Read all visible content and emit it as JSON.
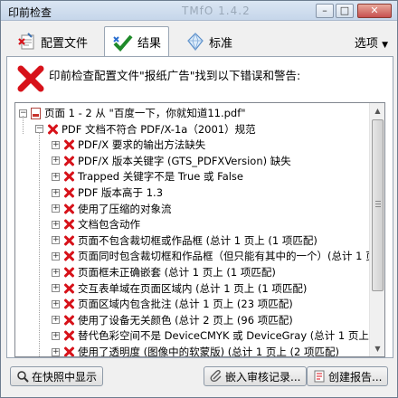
{
  "window": {
    "title": "印前检查",
    "faded_title": "TMfO 1.4.2",
    "buttons": {
      "minimize": "–",
      "maximize": "□",
      "close": "✕"
    }
  },
  "tabs": [
    {
      "label": "配置文件",
      "icon": "profile-icon",
      "active": false
    },
    {
      "label": "结果",
      "icon": "checkmark-icon",
      "active": true
    },
    {
      "label": "标准",
      "icon": "diamond-icon",
      "active": false
    }
  ],
  "options": {
    "label": "选项",
    "icon": "dropdown-arrow-icon"
  },
  "header": {
    "message": "印前检查配置文件\"报纸广告\"找到以下错误和警告:"
  },
  "tree": {
    "items": [
      {
        "text": "页面 1 - 2 从 \"百度一下，你就知道11.pdf\"",
        "level": 0,
        "expander": "-",
        "icon": "pdf"
      },
      {
        "text": "PDF 文档不符合 PDF/X-1a（2001）规范",
        "level": 1,
        "expander": "-",
        "icon": "x"
      },
      {
        "text": "PDF/X 要求的输出方法缺失",
        "level": 2,
        "expander": "+",
        "icon": "x"
      },
      {
        "text": "PDF/X 版本关键字 (GTS_PDFXVersion) 缺失",
        "level": 2,
        "expander": "+",
        "icon": "x"
      },
      {
        "text": "Trapped 关键字不是 True 或 False",
        "level": 2,
        "expander": "+",
        "icon": "x"
      },
      {
        "text": "PDF 版本高于 1.3",
        "level": 2,
        "expander": "+",
        "icon": "x"
      },
      {
        "text": "使用了压缩的对象流",
        "level": 2,
        "expander": "+",
        "icon": "x"
      },
      {
        "text": "文档包含动作",
        "level": 2,
        "expander": "+",
        "icon": "x"
      },
      {
        "text": "页面不包含裁切框或作品框 (总计 1 页上 (1 项匹配)",
        "level": 2,
        "expander": "+",
        "icon": "x"
      },
      {
        "text": "页面同时包含裁切框和作品框（但只能有其中的一个）(总计 1 页",
        "level": 2,
        "expander": "+",
        "icon": "x"
      },
      {
        "text": "页面框未正确嵌套 (总计 1 页上 (1 项匹配)",
        "level": 2,
        "expander": "+",
        "icon": "x"
      },
      {
        "text": "交互表单域在页面区域内 (总计 1 页上 (1 项匹配)",
        "level": 2,
        "expander": "+",
        "icon": "x"
      },
      {
        "text": "页面区域内包含批注 (总计 1 页上 (23 项匹配)",
        "level": 2,
        "expander": "+",
        "icon": "x"
      },
      {
        "text": "使用了设备无关颜色 (总计 2 页上 (96 项匹配)",
        "level": 2,
        "expander": "+",
        "icon": "x"
      },
      {
        "text": "替代色彩空间不是 DeviceCMYK 或 DeviceGray (总计 1 页上 (2 项匹",
        "level": 2,
        "expander": "+",
        "icon": "x"
      },
      {
        "text": "使用了透明度 (图像中的软蒙版) (总计 1 页上 (2 项匹配)",
        "level": 2,
        "expander": "+",
        "icon": "x"
      }
    ]
  },
  "bottom": {
    "show_in_snap": "在快照中显示",
    "embed_audit": "嵌入审核记录...",
    "create_report": "创建报告..."
  }
}
